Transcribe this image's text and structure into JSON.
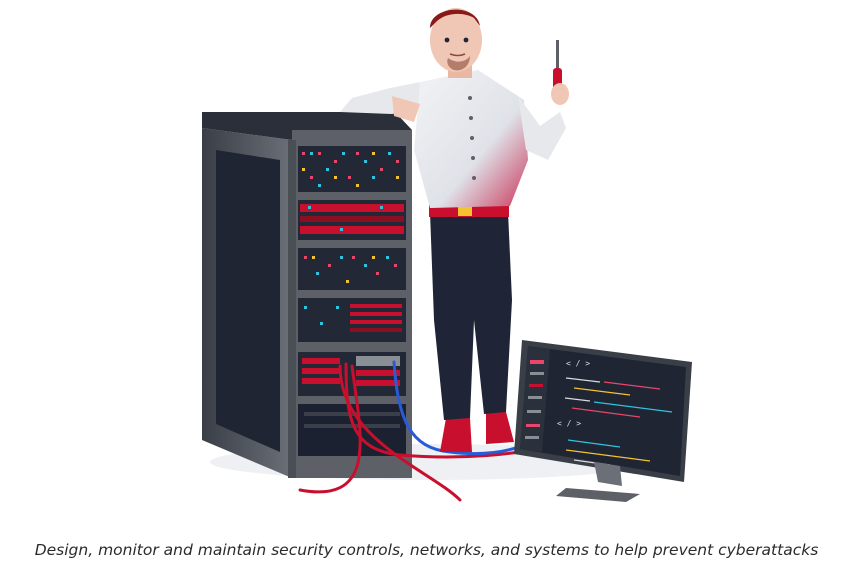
{
  "caption": "Design, monitor and maintain security controls, networks, and systems to help prevent cyberattacks",
  "monitor": {
    "code_tag_1": "< / >",
    "code_tag_2": "< / >"
  },
  "colors": {
    "accent_red": "#c8102e",
    "rack_gray": "#5d6167",
    "rack_dark": "#1f2533",
    "pants": "#1f2536",
    "shirt": "#e6e8ec",
    "cable_blue": "#2a5bd7"
  }
}
